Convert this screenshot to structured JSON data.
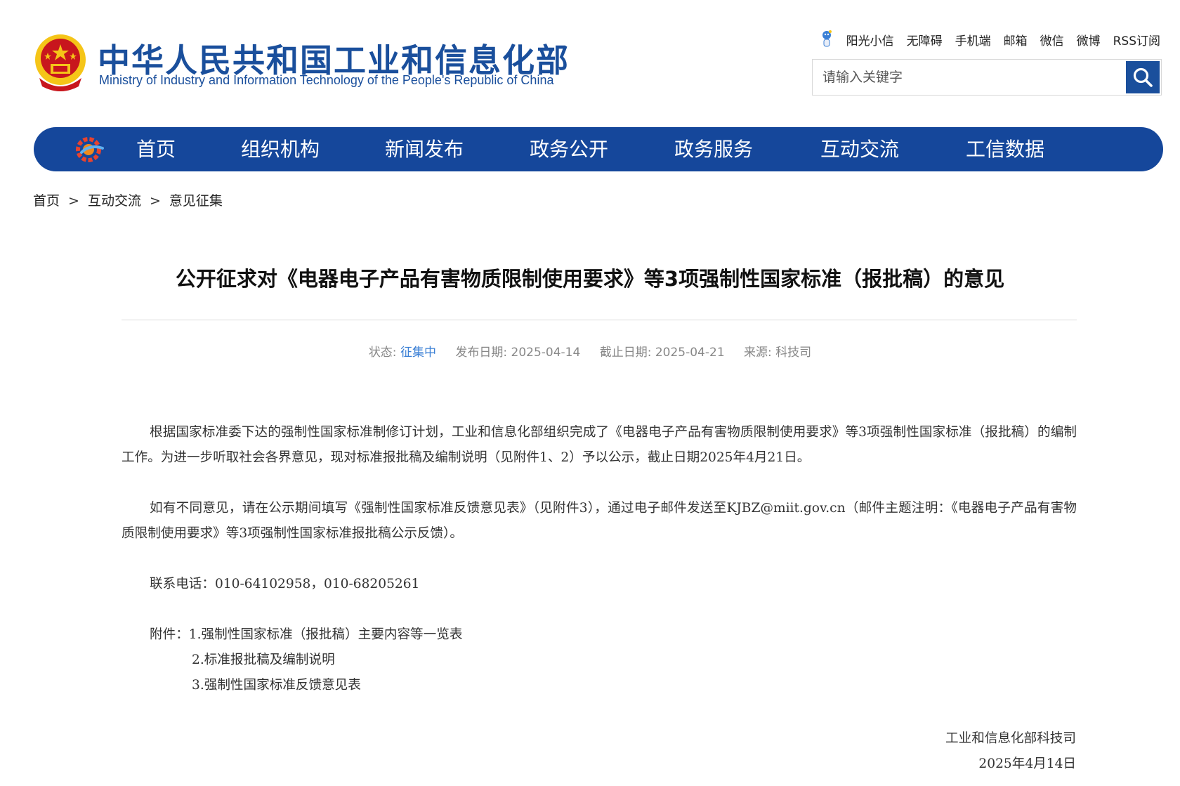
{
  "header": {
    "title_cn": "中华人民共和国工业和信息化部",
    "title_en": "Ministry of Industry and Information Technology of the People's Republic of China",
    "top_links": [
      "阳光小信",
      "无障碍",
      "手机端",
      "邮箱",
      "微信",
      "微博",
      "RSS订阅"
    ],
    "search_placeholder": "请输入关键字"
  },
  "nav": {
    "items": [
      "首页",
      "组织机构",
      "新闻发布",
      "政务公开",
      "政务服务",
      "互动交流",
      "工信数据"
    ]
  },
  "breadcrumb": {
    "items": [
      "首页",
      "互动交流",
      "意见征集"
    ],
    "separator": ">"
  },
  "article": {
    "title": "公开征求对《电器电子产品有害物质限制使用要求》等3项强制性国家标准（报批稿）的意见",
    "meta": {
      "status_label": "状态:",
      "status_value": "征集中",
      "publish_label": "发布日期:",
      "publish_date": "2025-04-14",
      "deadline_label": "截止日期:",
      "deadline_date": "2025-04-21",
      "source_label": "来源:",
      "source_value": "科技司"
    },
    "paragraphs": [
      "根据国家标准委下达的强制性国家标准制修订计划，工业和信息化部组织完成了《电器电子产品有害物质限制使用要求》等3项强制性国家标准（报批稿）的编制工作。为进一步听取社会各界意见，现对标准报批稿及编制说明（见附件1、2）予以公示，截止日期2025年4月21日。",
      "如有不同意见，请在公示期间填写《强制性国家标准反馈意见表》（见附件3），通过电子邮件发送至KJBZ@miit.gov.cn（邮件主题注明：《电器电子产品有害物质限制使用要求》等3项强制性国家标准报批稿公示反馈）。",
      "联系电话：010-64102958，010-68205261"
    ],
    "attachments_label": "附件：",
    "attachments": [
      "1.强制性国家标准（报批稿）主要内容等一览表",
      "2.标准报批稿及编制说明",
      "3.强制性国家标准反馈意见表"
    ],
    "signature_org": "工业和信息化部科技司",
    "signature_date": "2025年4月14日"
  },
  "colors": {
    "brand_blue": "#15479b",
    "status_blue": "#3a7fd5",
    "emblem_red": "#c8161d",
    "emblem_gold": "#f5c518"
  }
}
